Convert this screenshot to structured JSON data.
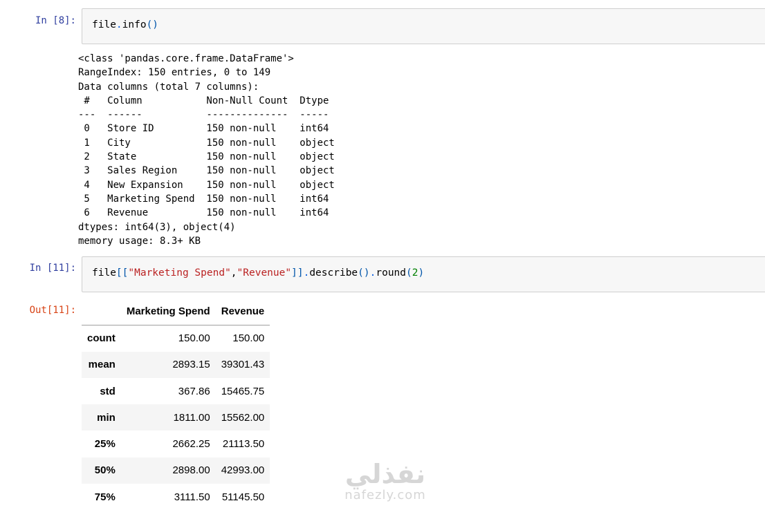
{
  "cells": [
    {
      "prompt": "In [8]:",
      "code": {
        "t0": "file",
        "t1": ".",
        "t2": "info",
        "t3": "()"
      },
      "output_lines": [
        "<class 'pandas.core.frame.DataFrame'>",
        "RangeIndex: 150 entries, 0 to 149",
        "Data columns (total 7 columns):",
        " #   Column           Non-Null Count  Dtype ",
        "---  ------           --------------  ----- ",
        " 0   Store ID         150 non-null    int64 ",
        " 1   City             150 non-null    object",
        " 2   State            150 non-null    object",
        " 3   Sales Region     150 non-null    object",
        " 4   New Expansion    150 non-null    object",
        " 5   Marketing Spend  150 non-null    int64 ",
        " 6   Revenue          150 non-null    int64 ",
        "dtypes: int64(3), object(4)",
        "memory usage: 8.3+ KB"
      ]
    },
    {
      "prompt": "In [11]:",
      "code": {
        "t0": "file",
        "t1": "[[",
        "t2": "\"Marketing Spend\"",
        "t3": ",",
        "t4": "\"Revenue\"",
        "t5": "]]",
        "t6": ".",
        "t7": "describe",
        "t8": "()",
        "t9": ".",
        "t10": "round",
        "t11": "(",
        "t12": "2",
        "t13": ")"
      },
      "out_prompt": "Out[11]:",
      "table": {
        "columns": [
          "Marketing Spend",
          "Revenue"
        ],
        "rows": [
          {
            "label": "count",
            "values": [
              "150.00",
              "150.00"
            ]
          },
          {
            "label": "mean",
            "values": [
              "2893.15",
              "39301.43"
            ]
          },
          {
            "label": "std",
            "values": [
              "367.86",
              "15465.75"
            ]
          },
          {
            "label": "min",
            "values": [
              "1811.00",
              "15562.00"
            ]
          },
          {
            "label": "25%",
            "values": [
              "2662.25",
              "21113.50"
            ]
          },
          {
            "label": "50%",
            "values": [
              "2898.00",
              "42993.00"
            ]
          },
          {
            "label": "75%",
            "values": [
              "3111.50",
              "51145.50"
            ]
          }
        ]
      }
    }
  ],
  "watermark": {
    "arabic": "نفذلي",
    "latin": "nafezly.com"
  }
}
